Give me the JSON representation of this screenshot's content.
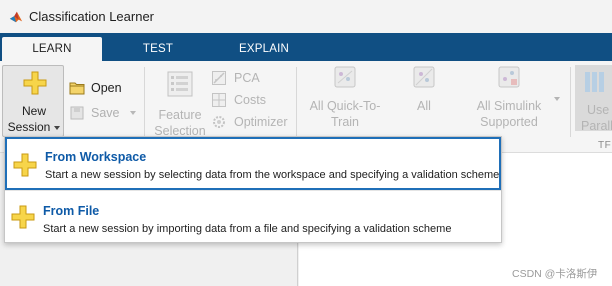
{
  "window": {
    "title": "Classification Learner"
  },
  "tabs": [
    {
      "label": "LEARN"
    },
    {
      "label": "TEST"
    },
    {
      "label": "EXPLAIN"
    }
  ],
  "ribbon": {
    "new_session": {
      "line1": "New",
      "line2": "Session"
    },
    "open_label": "Open",
    "save_label": "Save",
    "feature_selection": {
      "line1": "Feature",
      "line2": "Selection"
    },
    "pca_label": "PCA",
    "costs_label": "Costs",
    "optimizer_label": "Optimizer",
    "gallery": [
      {
        "line1": "All Quick-To-",
        "line2": "Train"
      },
      {
        "line1": "All",
        "line2": ""
      },
      {
        "line1": "All Simulink",
        "line2": "Supported"
      }
    ],
    "use_parallel": {
      "line1": "Use",
      "line2": "Paralle"
    },
    "section_fragment": "TF"
  },
  "menu": {
    "items": [
      {
        "title": "From Workspace",
        "description": "Start a new session by selecting data from the workspace and specifying a validation scheme"
      },
      {
        "title": "From File",
        "description": "Start a new session by importing data from a file and specifying a validation scheme"
      }
    ]
  },
  "watermark": "CSDN @卡洛斯伊",
  "colors": {
    "tab_strip": "#104f83",
    "plus_icon": "#f7d54a",
    "menu_title": "#0e5aa7",
    "menu_focus": "#1f6fb8"
  },
  "icons": {
    "app": "matlab-logo-icon",
    "new_session": "plus-icon",
    "open": "folder-icon",
    "save": "save-icon",
    "feature_selection": "feature-list-icon",
    "pca": "pca-icon",
    "costs": "costs-grid-icon",
    "optimizer": "gear-icon"
  }
}
